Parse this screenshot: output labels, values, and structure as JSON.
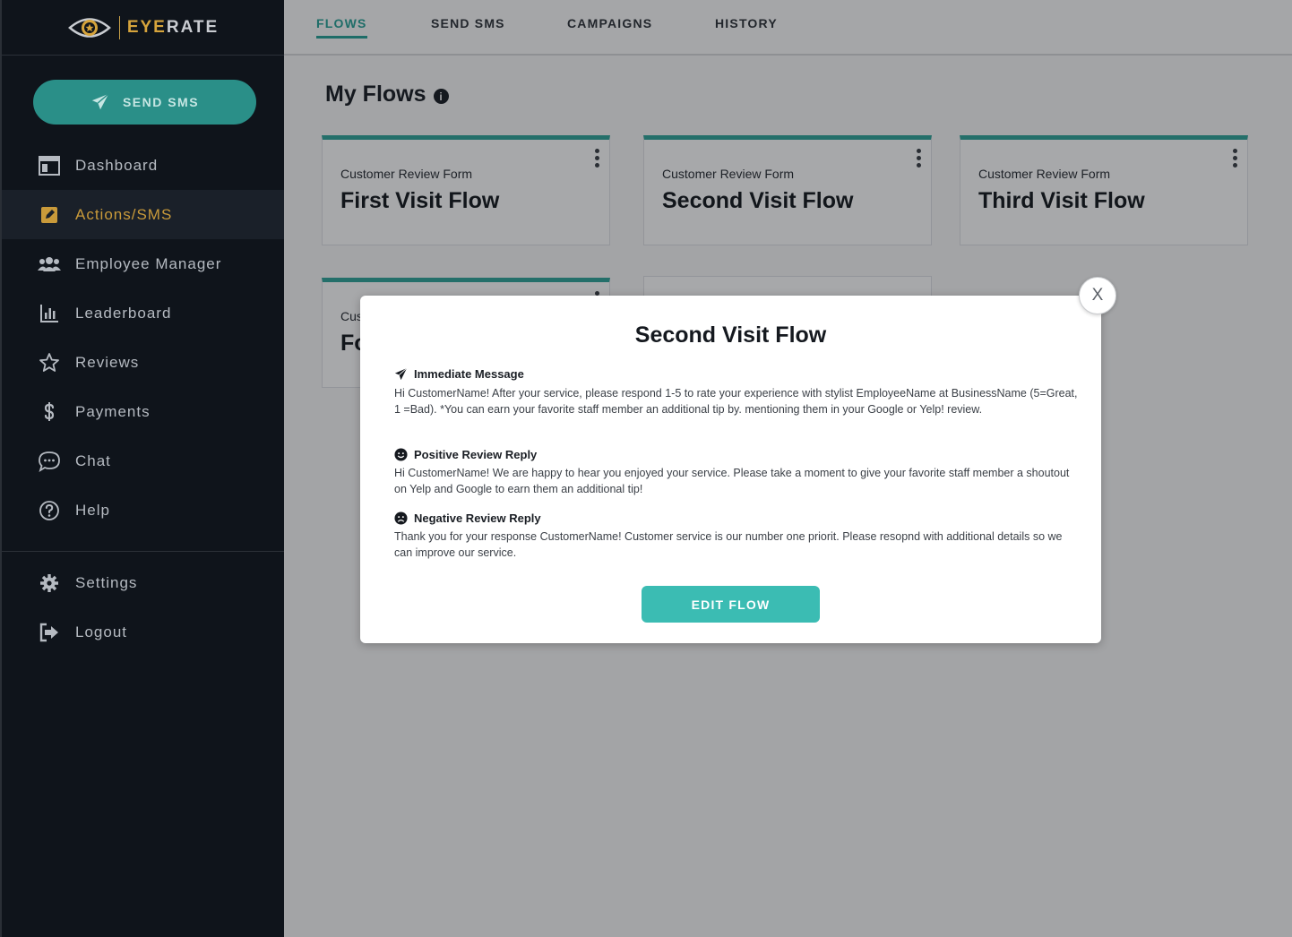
{
  "brand": {
    "eye": "EYE",
    "rate": "RATE",
    "colors": {
      "gold": "#d6a43c",
      "teal": "#2a8f88",
      "sidebar_bg": "#0f141b"
    }
  },
  "sidebar": {
    "send_sms_label": "SEND SMS",
    "items": [
      {
        "label": "Dashboard",
        "icon": "dashboard-icon"
      },
      {
        "label": "Actions/SMS",
        "icon": "edit-icon",
        "active": true
      },
      {
        "label": "Employee Manager",
        "icon": "users-icon"
      },
      {
        "label": "Leaderboard",
        "icon": "chart-icon"
      },
      {
        "label": "Reviews",
        "icon": "star-icon"
      },
      {
        "label": "Payments",
        "icon": "dollar-icon"
      },
      {
        "label": "Chat",
        "icon": "chat-icon"
      },
      {
        "label": "Help",
        "icon": "help-icon"
      }
    ],
    "bottom_items": [
      {
        "label": "Settings",
        "icon": "gear-icon"
      },
      {
        "label": "Logout",
        "icon": "logout-icon"
      }
    ]
  },
  "tabs": [
    {
      "label": "FLOWS",
      "active": true
    },
    {
      "label": "SEND SMS"
    },
    {
      "label": "CAMPAIGNS"
    },
    {
      "label": "HISTORY"
    }
  ],
  "main": {
    "title": "My Flows",
    "info_glyph": "i",
    "cards": [
      {
        "sub": "Customer Review Form",
        "name": "First Visit Flow"
      },
      {
        "sub": "Customer Review Form",
        "name": "Second Visit Flow"
      },
      {
        "sub": "Customer Review Form",
        "name": "Third Visit Flow"
      },
      {
        "sub": "Cus",
        "name": "Fo"
      }
    ]
  },
  "modal": {
    "title": "Second Visit Flow",
    "close_label": "X",
    "sections": [
      {
        "heading": "Immediate Message",
        "icon": "paper-plane-icon",
        "body": "Hi CustomerName! After your service, please respond 1-5 to rate your experience with stylist EmployeeName at BusinessName (5=Great, 1 =Bad). *You can earn your favorite staff member an additional tip by. mentioning them in your Google or Yelp! review."
      },
      {
        "heading": "Positive Review Reply",
        "icon": "smile-icon",
        "body": "Hi CustomerName! We are happy to hear you enjoyed your service. Please take a moment to give your favorite staff member a shoutout on Yelp and Google to earn them an additional tip!"
      },
      {
        "heading": "Negative Review Reply",
        "icon": "frown-icon",
        "body": "Thank you for your response CustomerName! Customer service is our number one priorit. Please resopnd with additional details so we can improve our service."
      }
    ],
    "edit_label": "EDIT FLOW"
  }
}
